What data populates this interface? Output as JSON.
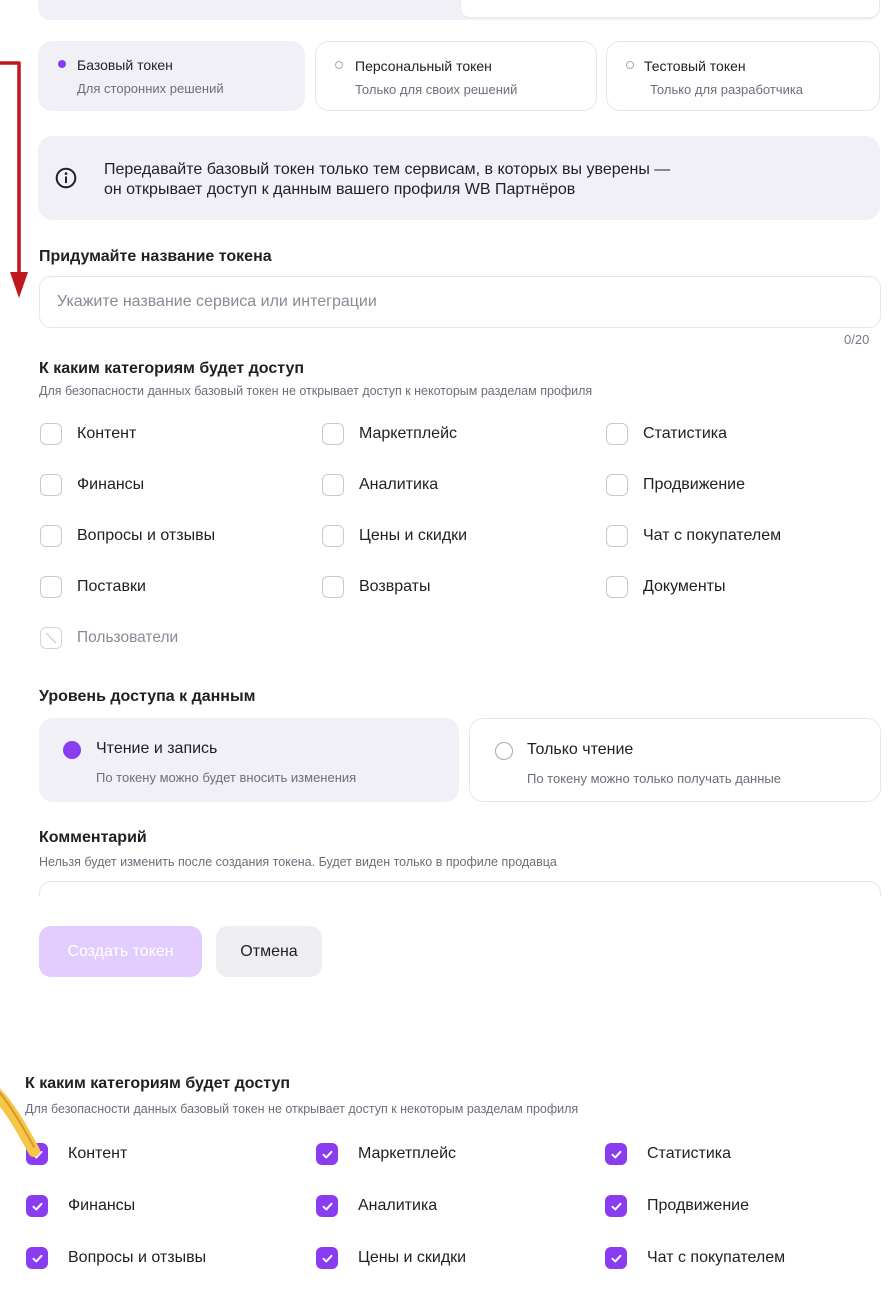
{
  "token_types": [
    {
      "title": "Базовый токен",
      "subtitle": "Для сторонних решений",
      "selected": true
    },
    {
      "title": "Персональный токен",
      "subtitle": "Только для своих решений",
      "selected": false
    },
    {
      "title": "Тестовый токен",
      "subtitle": "Только для разработчика",
      "selected": false
    }
  ],
  "banner": {
    "icon": "info-icon",
    "line1": "Передавайте базовый токен только тем сервисам, в которых вы уверены —",
    "line2": "он открывает доступ к данным вашего профиля WB Партнёров"
  },
  "name_field": {
    "label": "Придумайте название токена",
    "placeholder": "Укажите название сервиса или интеграции",
    "value": "",
    "counter": "0/20"
  },
  "categories": {
    "title": "К каким категориям будет доступ",
    "subtitle": "Для безопасности данных базовый токен не открывает доступ к некоторым разделам профиля",
    "items": [
      {
        "label": "Контент",
        "checked": false,
        "disabled": false
      },
      {
        "label": "Маркетплейс",
        "checked": false,
        "disabled": false
      },
      {
        "label": "Статистика",
        "checked": false,
        "disabled": false
      },
      {
        "label": "Финансы",
        "checked": false,
        "disabled": false
      },
      {
        "label": "Аналитика",
        "checked": false,
        "disabled": false
      },
      {
        "label": "Продвижение",
        "checked": false,
        "disabled": false
      },
      {
        "label": "Вопросы и отзывы",
        "checked": false,
        "disabled": false
      },
      {
        "label": "Цены и скидки",
        "checked": false,
        "disabled": false
      },
      {
        "label": "Чат с покупателем",
        "checked": false,
        "disabled": false
      },
      {
        "label": "Поставки",
        "checked": false,
        "disabled": false
      },
      {
        "label": "Возвраты",
        "checked": false,
        "disabled": false
      },
      {
        "label": "Документы",
        "checked": false,
        "disabled": false
      },
      {
        "label": "Пользователи",
        "checked": false,
        "disabled": true
      }
    ]
  },
  "access_level": {
    "title": "Уровень доступа к данным",
    "options": [
      {
        "title": "Чтение и запись",
        "subtitle": "По токену можно будет вносить изменения",
        "selected": true
      },
      {
        "title": "Только чтение",
        "subtitle": "По токену можно только получать данные",
        "selected": false
      }
    ]
  },
  "comment": {
    "label": "Комментарий",
    "hint": "Нельзя будет изменить после создания токена. Будет виден только в профиле продавца"
  },
  "buttons": {
    "create": "Создать токен",
    "cancel": "Отмена"
  },
  "categories_checked": {
    "title": "К каким категориям будет доступ",
    "subtitle": "Для безопасности данных базовый токен не открывает доступ к некоторым разделам профиля",
    "items": [
      {
        "label": "Контент",
        "checked": true
      },
      {
        "label": "Маркетплейс",
        "checked": true
      },
      {
        "label": "Статистика",
        "checked": true
      },
      {
        "label": "Финансы",
        "checked": true
      },
      {
        "label": "Аналитика",
        "checked": true
      },
      {
        "label": "Продвижение",
        "checked": true
      },
      {
        "label": "Вопросы и отзывы",
        "checked": true
      },
      {
        "label": "Цены и скидки",
        "checked": true
      },
      {
        "label": "Чат с покупателем",
        "checked": true
      }
    ]
  },
  "colors": {
    "accent": "#8a3cf0",
    "accent_disabled": "#e3cdff",
    "annotation_arrow": "#c0161d",
    "annotation_highlight": "#f5c64a"
  }
}
